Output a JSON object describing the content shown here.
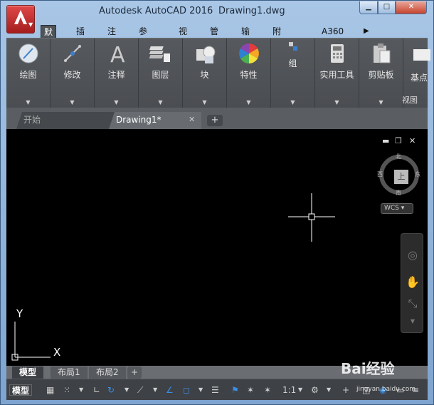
{
  "title": {
    "app": "Autodesk AutoCAD 2016",
    "document": "Drawing1.dwg"
  },
  "window_controls": {
    "minimize": "▁",
    "maximize": "□",
    "close": "✕"
  },
  "ribbon_tabs": [
    {
      "label": "默认"
    },
    {
      "label": "插入"
    },
    {
      "label": "注释"
    },
    {
      "label": "参数化"
    },
    {
      "label": "视图"
    },
    {
      "label": "管理"
    },
    {
      "label": "输出"
    },
    {
      "label": "附加模块"
    },
    {
      "label": "A360"
    },
    {
      "label": "▶ ▾"
    }
  ],
  "ribbon_panels": [
    {
      "label": "绘图",
      "icon": "draw-icon"
    },
    {
      "label": "修改",
      "icon": "modify-icon"
    },
    {
      "label": "注释",
      "icon": "annotation-icon"
    },
    {
      "label": "图层",
      "icon": "layers-icon"
    },
    {
      "label": "块",
      "icon": "block-icon"
    },
    {
      "label": "特性",
      "icon": "properties-icon"
    },
    {
      "label": "组",
      "icon": "group-icon"
    },
    {
      "label": "实用工具",
      "icon": "calculator-icon"
    },
    {
      "label": "剪贴板",
      "icon": "clipboard-icon"
    },
    {
      "label": "基点",
      "icon": "basepoint-icon"
    }
  ],
  "view_panel_label": "视图",
  "doc_tabs": [
    {
      "label": "开始"
    },
    {
      "label": "Drawing1*"
    }
  ],
  "doc_tab_close": "✕",
  "doc_tab_add": "+",
  "canvas": {
    "controls": [
      "▬",
      "❐",
      "✕"
    ],
    "compass": {
      "north": "北",
      "south": "南",
      "east": "东",
      "west": "西",
      "face": "上"
    },
    "wcs": "WCS ▾",
    "ucs_axes": {
      "x": "X",
      "y": "Y"
    }
  },
  "layout_tabs": [
    {
      "label": "模型"
    },
    {
      "label": "布局1"
    },
    {
      "label": "布局2"
    }
  ],
  "layout_tab_add": "+",
  "status_bar": {
    "model": "模型",
    "scale": "1:1"
  },
  "watermark": {
    "text": "Bai经验",
    "url": "jingyan.baidu.com"
  }
}
